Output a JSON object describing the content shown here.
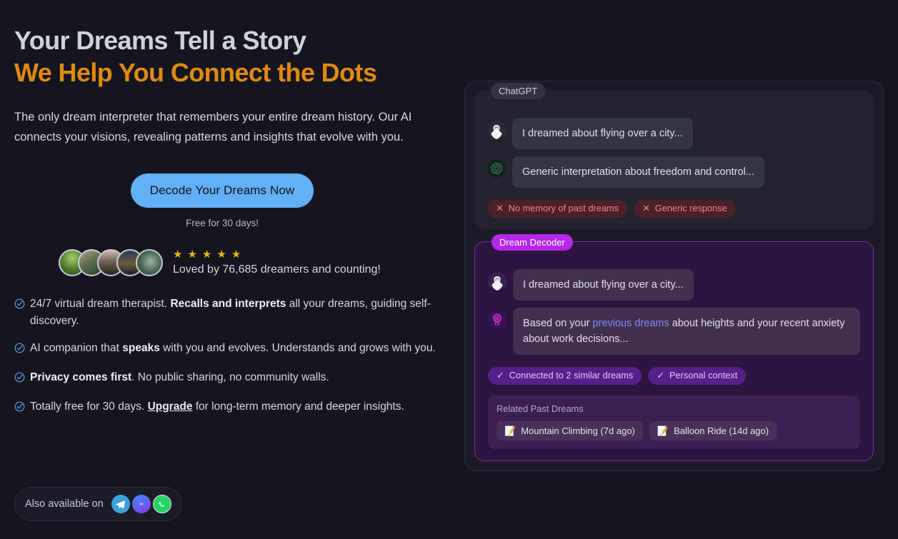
{
  "hero": {
    "headline_line1": "Your Dreams Tell a Story",
    "headline_line2": "We Help You Connect the Dots",
    "subtitle": "The only dream interpreter that remembers your entire dream history. Our AI connects your visions, revealing patterns and insights that evolve with you.",
    "cta_label": "Decode Your Dreams Now",
    "cta_note": "Free for 30 days!",
    "stars": 5,
    "loved_text": "Loved by 76,685 dreamers and counting!",
    "accent_orange": "#e08a12",
    "cta_blue": "#62b0f6",
    "star_gold": "#e8b710"
  },
  "features": [
    {
      "pre": "24/7 virtual dream therapist. ",
      "bold": "Recalls and interprets",
      "post": " all your dreams, guiding self-discovery."
    },
    {
      "pre": "AI companion that ",
      "bold": "speaks",
      "post": " with you and evolves. Understands and grows with you."
    },
    {
      "pre": "",
      "bold": "Privacy comes first",
      "post": ". No public sharing, no community walls."
    },
    {
      "pre": "Totally free for 30 days. ",
      "link": "Upgrade",
      "post": " for long-term memory and deeper insights."
    }
  ],
  "also": {
    "label": "Also available on",
    "channels": [
      {
        "name": "telegram",
        "color": "#3ba2db"
      },
      {
        "name": "messenger",
        "color": "#3d8bff"
      },
      {
        "name": "whatsapp",
        "color": "#25d366"
      }
    ]
  },
  "comparison": {
    "chatgpt": {
      "badge": "ChatGPT",
      "messages": [
        {
          "role": "user",
          "text": "I dreamed about flying over a city..."
        },
        {
          "role": "assistant",
          "text": "Generic interpretation about freedom and control..."
        }
      ],
      "tags": [
        {
          "icon": "✕",
          "label": "No memory of past dreams"
        },
        {
          "icon": "✕",
          "label": "Generic response"
        }
      ]
    },
    "decoder": {
      "badge": "Dream Decoder",
      "messages": [
        {
          "role": "user",
          "text": "I dreamed about flying over a city..."
        },
        {
          "role": "assistant",
          "pre": "Based on your ",
          "link": "previous dreams",
          "post": " about heights and your recent anxiety about work decisions..."
        }
      ],
      "tags": [
        {
          "icon": "✓",
          "label": "Connected to 2 similar dreams"
        },
        {
          "icon": "✓",
          "label": "Personal context"
        }
      ],
      "related_title": "Related Past Dreams",
      "related_chips": [
        {
          "icon": "📝",
          "label": "Mountain Climbing (7d ago)"
        },
        {
          "icon": "📝",
          "label": "Balloon Ride (14d ago)"
        }
      ]
    }
  }
}
